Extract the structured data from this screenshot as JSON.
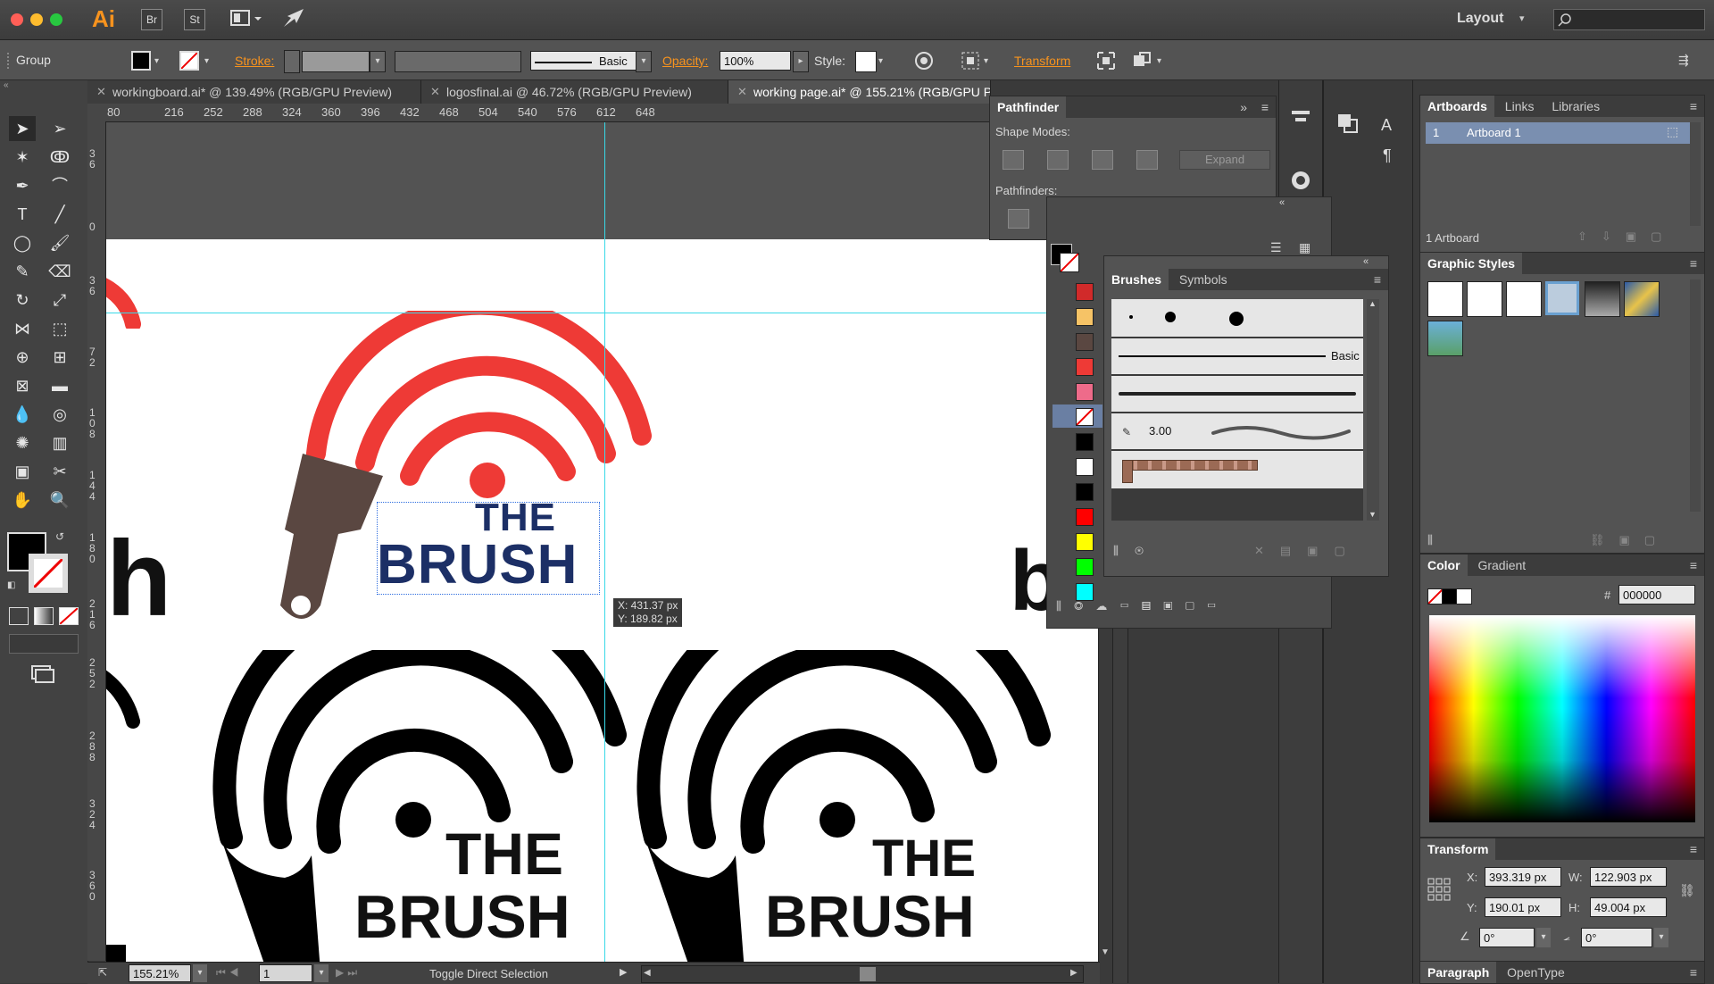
{
  "app": {
    "logo": "Ai",
    "bridge": "Br",
    "stock": "St",
    "workspace": "Layout",
    "search_placeholder": ""
  },
  "control_bar": {
    "selection_type": "Group",
    "stroke_label": "Stroke:",
    "brush_style": "Basic",
    "opacity_label": "Opacity:",
    "opacity_value": "100%",
    "style_label": "Style:",
    "transform_label": "Transform"
  },
  "tabs": [
    {
      "label": "workingboard.ai* @ 139.49% (RGB/GPU Preview)"
    },
    {
      "label": "logosfinal.ai @ 46.72% (RGB/GPU Preview)"
    },
    {
      "label": "working page.ai* @ 155.21% (RGB/GPU Preview)"
    }
  ],
  "ruler": {
    "h_ticks": [
      "80",
      "216",
      "252",
      "288",
      "324",
      "360",
      "396",
      "432",
      "468",
      "504",
      "540",
      "576",
      "612",
      "648"
    ],
    "v_ticks": [
      "36",
      "0",
      "36",
      "72",
      "108",
      "144",
      "180",
      "216",
      "252",
      "288",
      "324",
      "360"
    ]
  },
  "canvas": {
    "logo_line1": "THE",
    "logo_line2": "BRUSH",
    "partial_h": "h",
    "partial_br": "br",
    "cursor_x": "X: 431.37 px",
    "cursor_y": "Y: 189.82 px"
  },
  "status": {
    "zoom": "155.21%",
    "artboard_index": "1",
    "tool_hint": "Toggle Direct Selection"
  },
  "pathfinder": {
    "title": "Pathfinder",
    "shape_modes": "Shape Modes:",
    "expand": "Expand",
    "pathfinders": "Pathfinders:"
  },
  "brushes": {
    "tab_brushes": "Brushes",
    "tab_symbols": "Symbols",
    "basic": "Basic",
    "size_value": "3.00"
  },
  "artboards_panel": {
    "tab_artboards": "Artboards",
    "tab_links": "Links",
    "tab_libraries": "Libraries",
    "row_index": "1",
    "row_name": "Artboard 1",
    "count": "1 Artboard"
  },
  "graphic_styles": {
    "title": "Graphic Styles"
  },
  "color_panel": {
    "tab_color": "Color",
    "tab_gradient": "Gradient",
    "hash": "#",
    "hex": "000000"
  },
  "transform_panel": {
    "title": "Transform",
    "x_label": "X:",
    "x_value": "393.319 px",
    "y_label": "Y:",
    "y_value": "190.01 px",
    "w_label": "W:",
    "w_value": "122.903 px",
    "h_label": "H:",
    "h_value": "49.004 px",
    "rotate_value": "0°",
    "shear_value": "0°"
  },
  "paragraph_panel": {
    "tab_paragraph": "Paragraph",
    "tab_opentype": "OpenType"
  },
  "colors": {
    "accent": "#f7931e",
    "red_logo": "#ee3a36",
    "brown_handle": "#5a4741",
    "guide": "#39d9e8",
    "selection": "#2f6ee0"
  }
}
